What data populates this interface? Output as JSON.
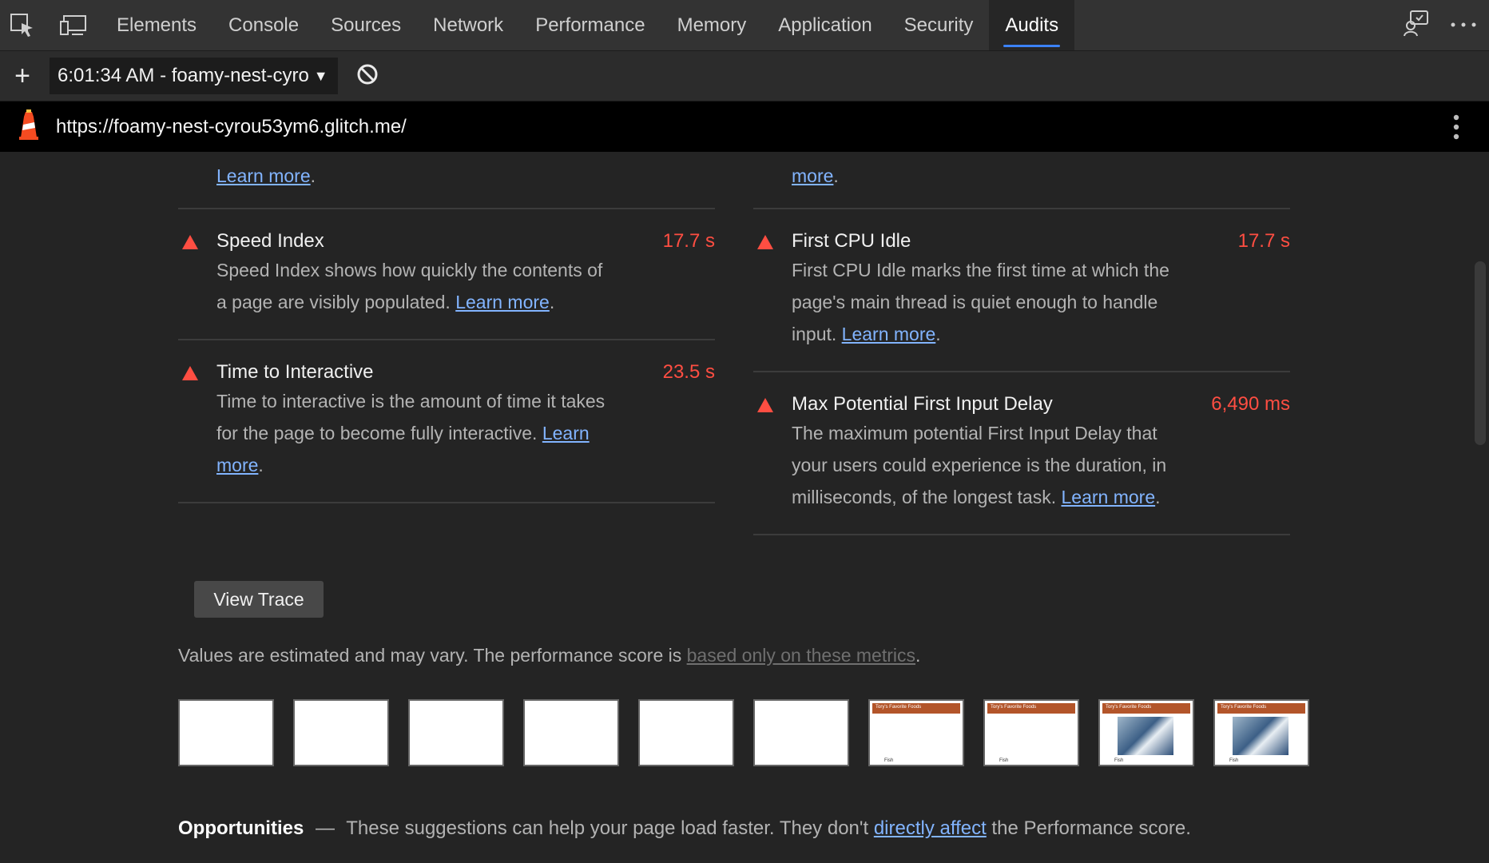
{
  "tabs": [
    "Elements",
    "Console",
    "Sources",
    "Network",
    "Performance",
    "Memory",
    "Application",
    "Security",
    "Audits"
  ],
  "active_tab": "Audits",
  "toolbar": {
    "add_label": "+",
    "report_label": "6:01:34 AM - foamy-nest-cyro"
  },
  "url": "https://foamy-nest-cyrou53ym6.glitch.me/",
  "partial_top": {
    "left_link": "Learn more",
    "right_link": "more"
  },
  "audits_left": [
    {
      "title": "Speed Index",
      "value": "17.7 s",
      "desc": "Speed Index shows how quickly the contents of a page are visibly populated.",
      "link": "Learn more"
    },
    {
      "title": "Time to Interactive",
      "value": "23.5 s",
      "desc": "Time to interactive is the amount of time it takes for the page to become fully interactive.",
      "link": "Learn more"
    }
  ],
  "audits_right": [
    {
      "title": "First CPU Idle",
      "value": "17.7 s",
      "desc": "First CPU Idle marks the first time at which the page's main thread is quiet enough to handle input.",
      "link": "Learn more"
    },
    {
      "title": "Max Potential First Input Delay",
      "value": "6,490 ms",
      "desc": "The maximum potential First Input Delay that your users could experience is the duration, in milliseconds, of the longest task.",
      "link": "Learn more"
    }
  ],
  "view_trace_label": "View Trace",
  "note": {
    "text": "Values are estimated and may vary. The performance score is ",
    "link": "based only on these metrics",
    "end": "."
  },
  "filmstrip": [
    {
      "state": "blank"
    },
    {
      "state": "blank"
    },
    {
      "state": "blank"
    },
    {
      "state": "blank"
    },
    {
      "state": "blank"
    },
    {
      "state": "blank"
    },
    {
      "state": "header",
      "header_text": "Tory's Favorite Foods",
      "caption": "Fish"
    },
    {
      "state": "header",
      "header_text": "Tory's Favorite Foods",
      "caption": "Fish"
    },
    {
      "state": "image",
      "header_text": "Tory's Favorite Foods",
      "caption": "Fish"
    },
    {
      "state": "image",
      "header_text": "Tory's Favorite Foods",
      "caption": "Fish"
    }
  ],
  "opportunities": {
    "heading": "Opportunities",
    "dash": "—",
    "text": "These suggestions can help your page load faster. They don't ",
    "link": "directly affect",
    "end": " the Performance score."
  },
  "colors": {
    "fail": "#ff4e42",
    "link": "#82b4ff",
    "accent": "#3b82f6"
  }
}
